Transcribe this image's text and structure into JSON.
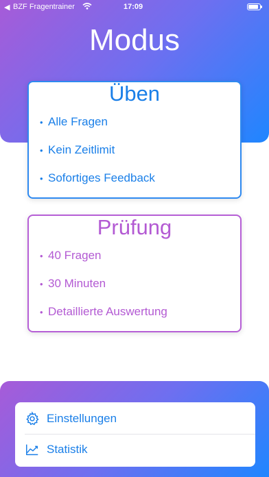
{
  "status_bar": {
    "back_glyph": "◀",
    "app_name": "BZF Fragentrainer",
    "time": "17:09"
  },
  "page": {
    "title": "Modus"
  },
  "modes": [
    {
      "title": "Üben",
      "accent": "#1a7fe8",
      "features": [
        "Alle Fragen",
        "Kein Zeitlimit",
        "Sofortiges Feedback"
      ]
    },
    {
      "title": "Prüfung",
      "accent": "#b35ad3",
      "features": [
        "40 Fragen",
        "30 Minuten",
        "Detaillierte Auswertung"
      ]
    }
  ],
  "menu": {
    "settings": {
      "label": "Einstellungen",
      "icon": "gear-icon"
    },
    "statistics": {
      "label": "Statistik",
      "icon": "chart-icon"
    }
  },
  "colors": {
    "gradient_start": "#a75bd8",
    "gradient_end": "#1f86ff",
    "practice": "#1a7fe8",
    "exam": "#b35ad3"
  }
}
